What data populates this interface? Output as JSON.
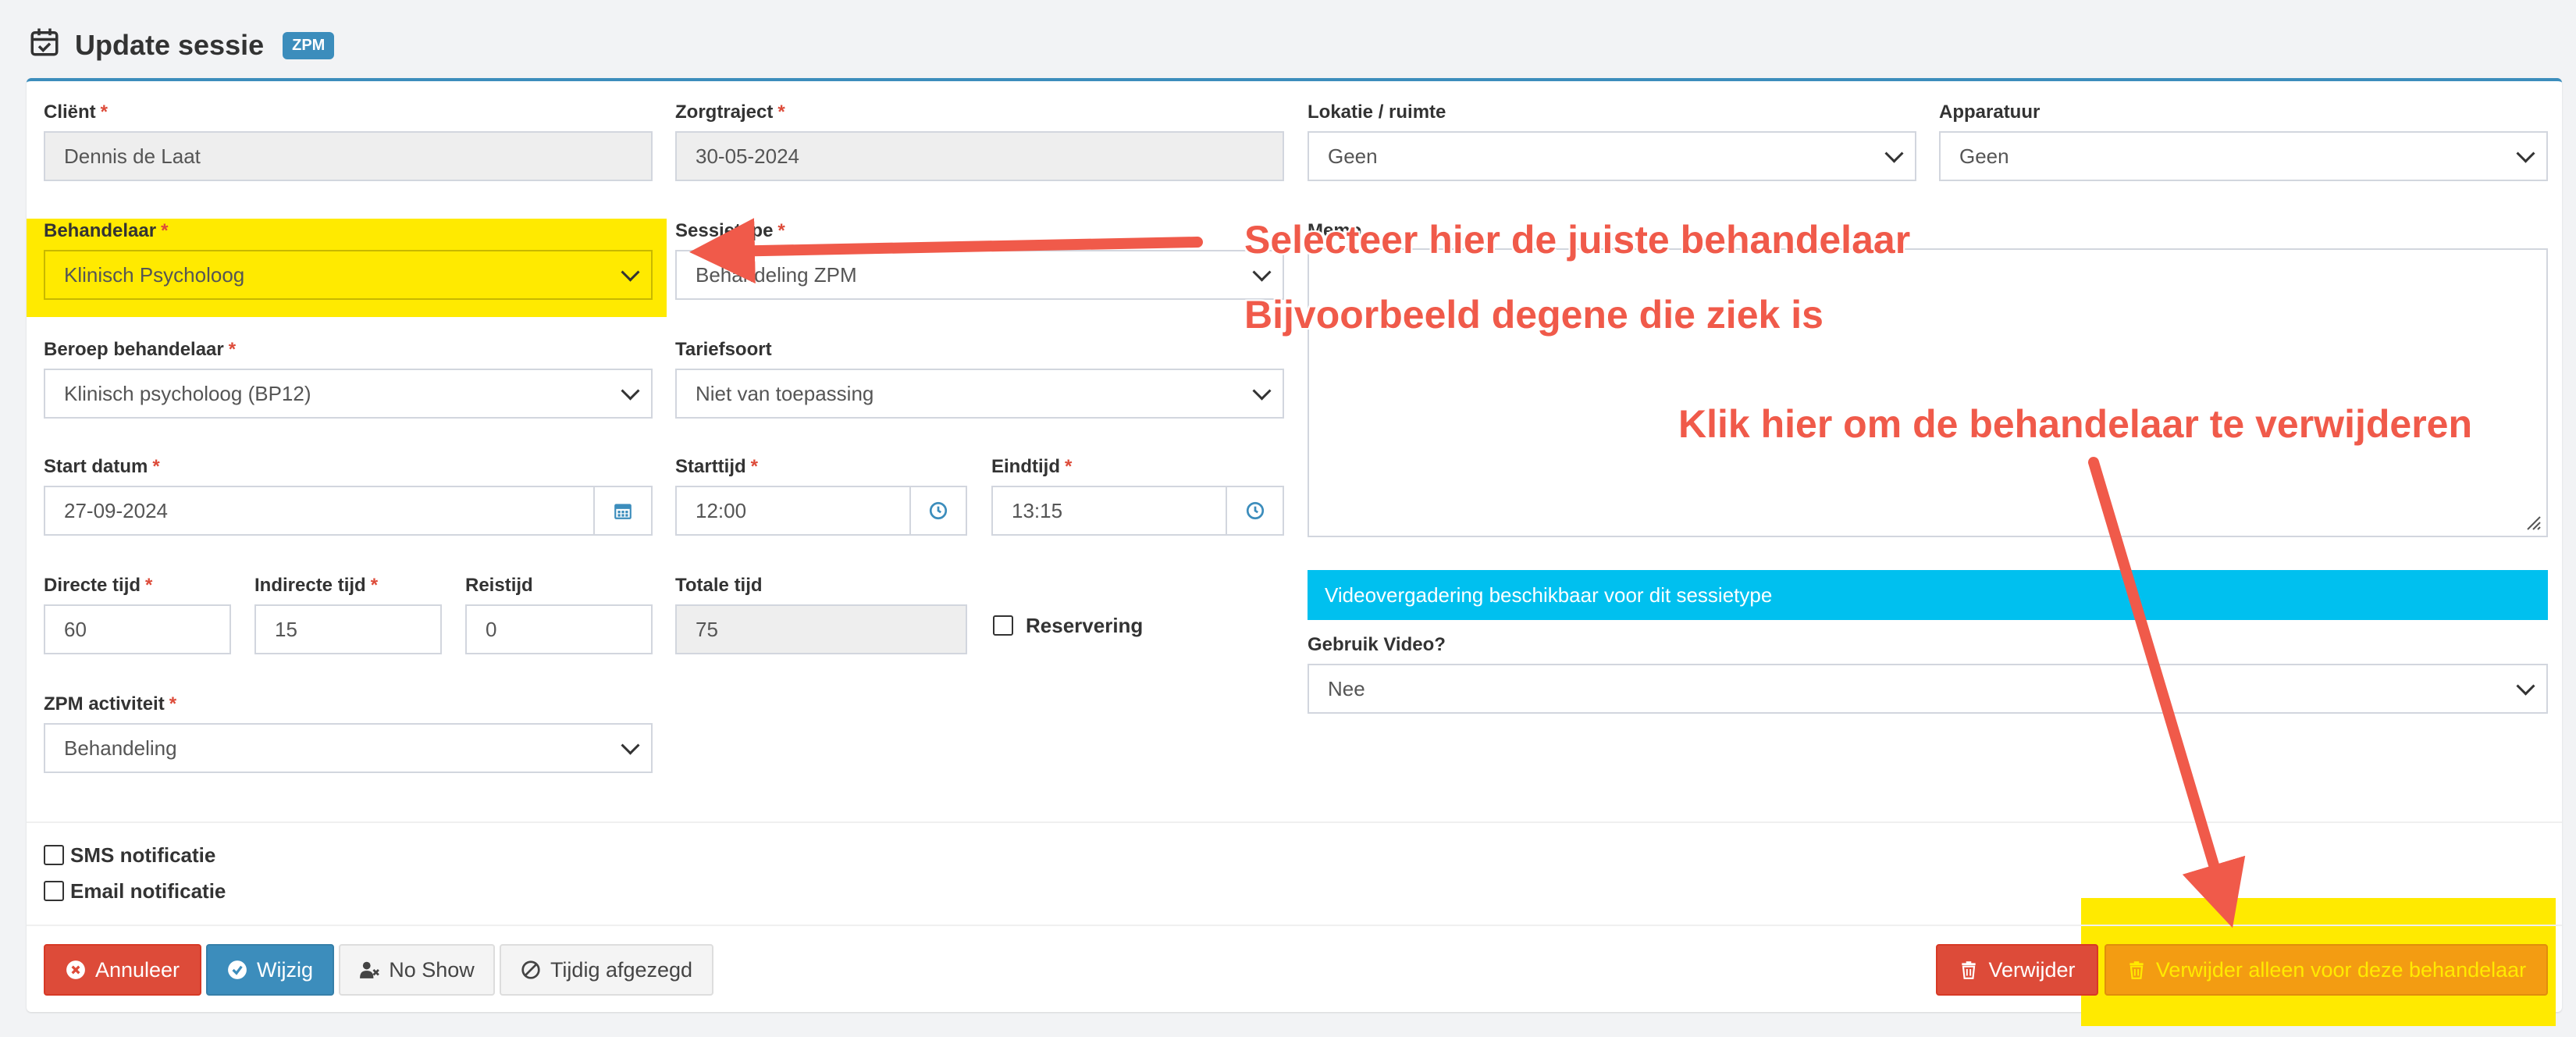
{
  "header": {
    "title": "Update sessie",
    "badge": "ZPM"
  },
  "form": {
    "client": {
      "label": "Cliënt",
      "value": "Dennis de Laat"
    },
    "zorgtraject": {
      "label": "Zorgtraject",
      "value": "30-05-2024"
    },
    "lokatie": {
      "label": "Lokatie / ruimte",
      "value": "Geen"
    },
    "apparatuur": {
      "label": "Apparatuur",
      "value": "Geen"
    },
    "behandelaar": {
      "label": "Behandelaar",
      "value": "Klinisch Psycholoog"
    },
    "sessietype": {
      "label": "Sessietype",
      "value": "Behandeling ZPM"
    },
    "memo": {
      "label": "Memo"
    },
    "beroep": {
      "label": "Beroep behandelaar",
      "value": "Klinisch psycholoog (BP12)"
    },
    "tariefsoort": {
      "label": "Tariefsoort",
      "value": "Niet van toepassing"
    },
    "start_datum": {
      "label": "Start datum",
      "value": "27-09-2024"
    },
    "starttijd": {
      "label": "Starttijd",
      "value": "12:00"
    },
    "eindtijd": {
      "label": "Eindtijd",
      "value": "13:15"
    },
    "directe_tijd": {
      "label": "Directe tijd",
      "value": "60"
    },
    "indirecte_tijd": {
      "label": "Indirecte tijd",
      "value": "15"
    },
    "reistijd": {
      "label": "Reistijd",
      "value": "0"
    },
    "totale_tijd": {
      "label": "Totale tijd",
      "value": "75"
    },
    "reservering": {
      "label": "Reservering"
    },
    "video_notice": "Videovergadering beschikbaar voor dit sessietype",
    "gebruik_video": {
      "label": "Gebruik Video?",
      "value": "Nee"
    },
    "zpm_activiteit": {
      "label": "ZPM activiteit",
      "value": "Behandeling"
    },
    "sms": {
      "label": "SMS notificatie"
    },
    "email": {
      "label": "Email notificatie"
    },
    "required_mark": "*"
  },
  "buttons": {
    "annuleer": "Annuleer",
    "wijzig": "Wijzig",
    "no_show": "No Show",
    "tijdig": "Tijdig afgezegd",
    "verwijder": "Verwijder",
    "verwijder_behandelaar": "Verwijder alleen voor deze behandelaar"
  },
  "annotations": {
    "line1": "Selecteer hier de juiste behandelaar",
    "line2": "Bijvoorbeeld degene die ziek is",
    "line3": "Klik hier om de behandelaar te verwijderen"
  },
  "colors": {
    "highlight": "#ffea00",
    "annotation": "#f05a4a",
    "primary": "#3c8dbc",
    "danger": "#dd4b39",
    "warning": "#f39c12",
    "info": "#00c0ef"
  }
}
